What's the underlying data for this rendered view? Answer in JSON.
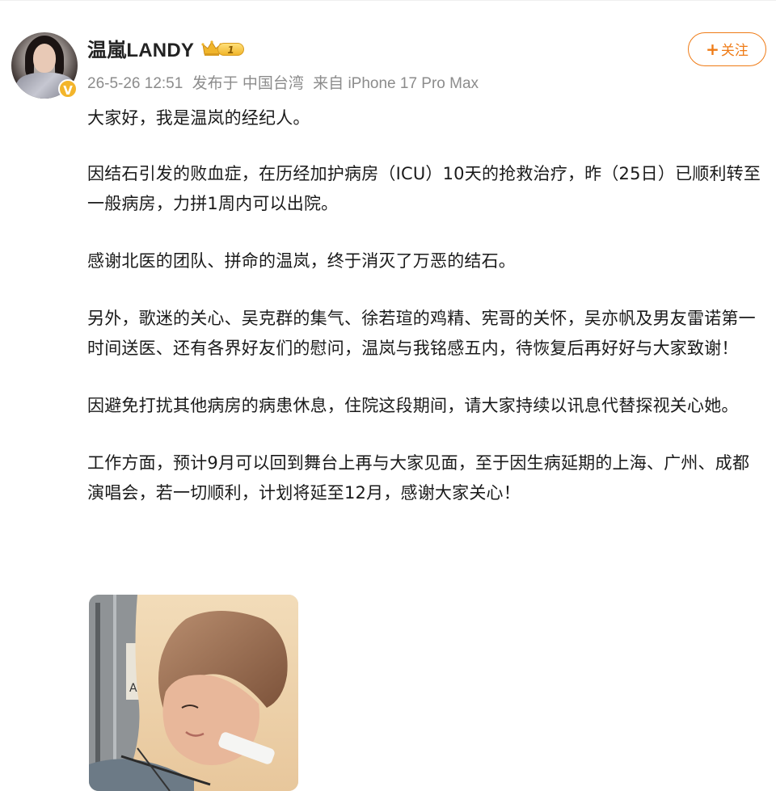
{
  "post": {
    "user": {
      "name": "温嵐LANDY",
      "level": "1"
    },
    "meta": {
      "time": "26-5-26 12:51",
      "location_label": "发布于 中国台湾",
      "source": "来自 iPhone 17 Pro Max"
    },
    "follow": {
      "label": "关注",
      "plus": "+"
    },
    "paragraphs": [
      "大家好，我是温岚的经纪人。",
      "因结石引发的败血症，在历经加护病房（ICU）10天的抢救治疗，昨（25日）已顺利转至一般病房，力拼1周内可以出院。",
      "感谢北医的团队、拼命的温岚，终于消灭了万恶的结石。",
      "另外，歌迷的关心、吴克群的集气、徐若瑄的鸡精、宪哥的关怀，吴亦帆及男友雷诺第一时间送医、还有各界好友们的慰问，温岚与我铭感五内，待恢复后再好好与大家致谢！",
      "因避免打扰其他病房的病患休息，住院这段期间，请大家持续以讯息代替探视关心她。",
      "工作方面，预计9月可以回到舞台上再与大家见面，至于因生病延期的上海、广州、成都演唱会，若一切顺利，计划将延至12月，感谢大家关心！"
    ],
    "colors": {
      "accent": "#ef7b16",
      "badge": "#f3b52b",
      "meta": "#8c8c8c"
    }
  }
}
